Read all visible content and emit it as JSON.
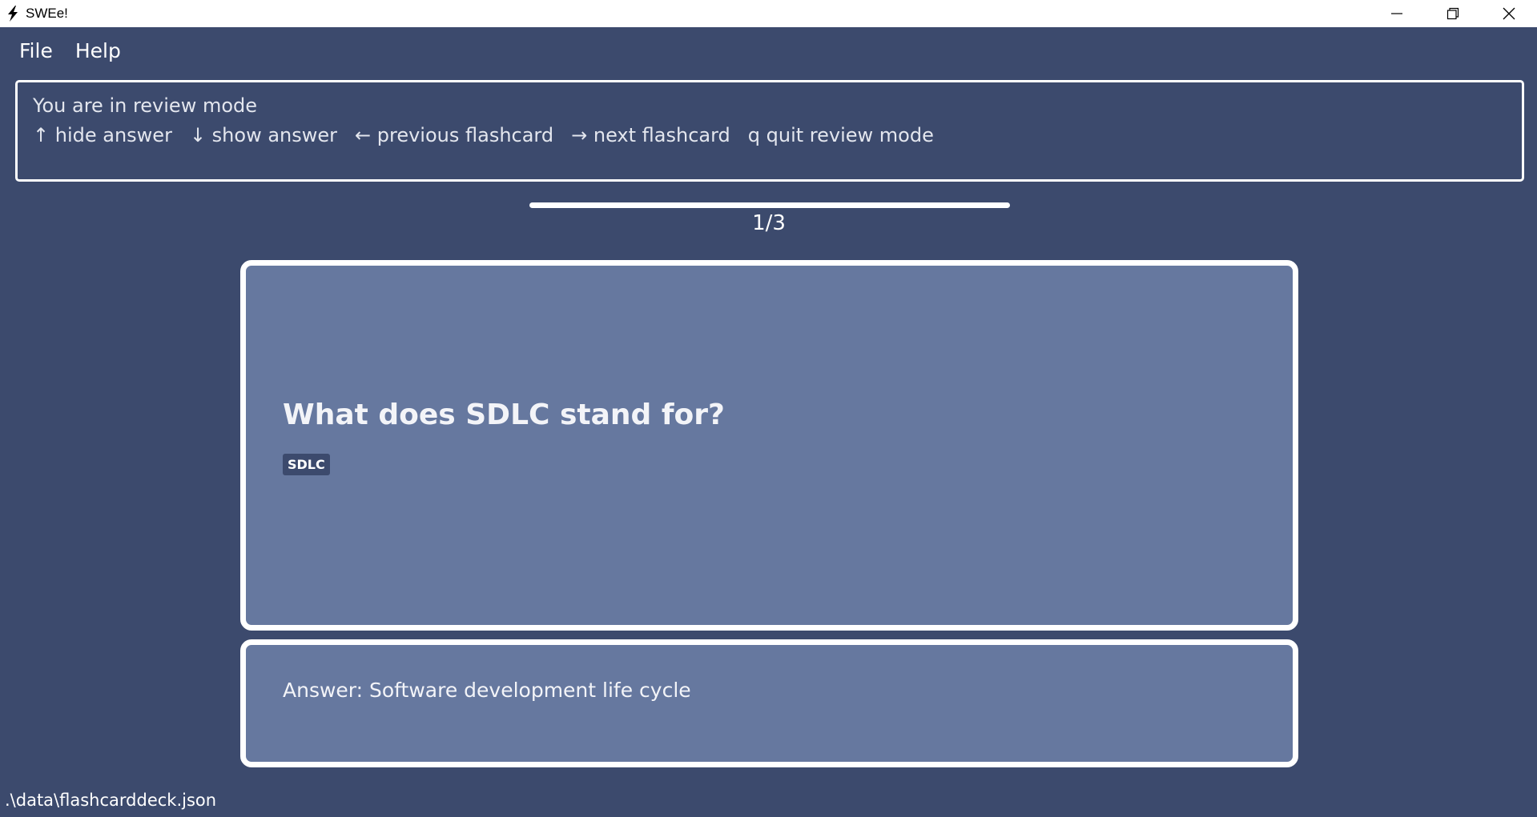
{
  "window": {
    "title": "SWEe!",
    "app_icon": "lightning-icon",
    "controls": [
      "minimize-icon",
      "restore-icon",
      "close-icon"
    ]
  },
  "menu": {
    "items": [
      "File",
      "Help"
    ]
  },
  "instructions": {
    "title": "You are in review mode",
    "keys": [
      "↑ hide answer",
      "↓ show answer",
      "← previous flashcard",
      "→ next flashcard",
      "q quit review mode"
    ]
  },
  "progress": {
    "label": "1/3",
    "fraction": 1.0
  },
  "flashcard": {
    "question": "What does SDLC stand for?",
    "tag": "SDLC",
    "answer": "Answer: Software development life cycle"
  },
  "status": {
    "file_path": ".\\data\\flashcarddeck.json"
  },
  "colors": {
    "background": "#3c4a6d",
    "card": "#66789f",
    "border": "#ffffff"
  }
}
